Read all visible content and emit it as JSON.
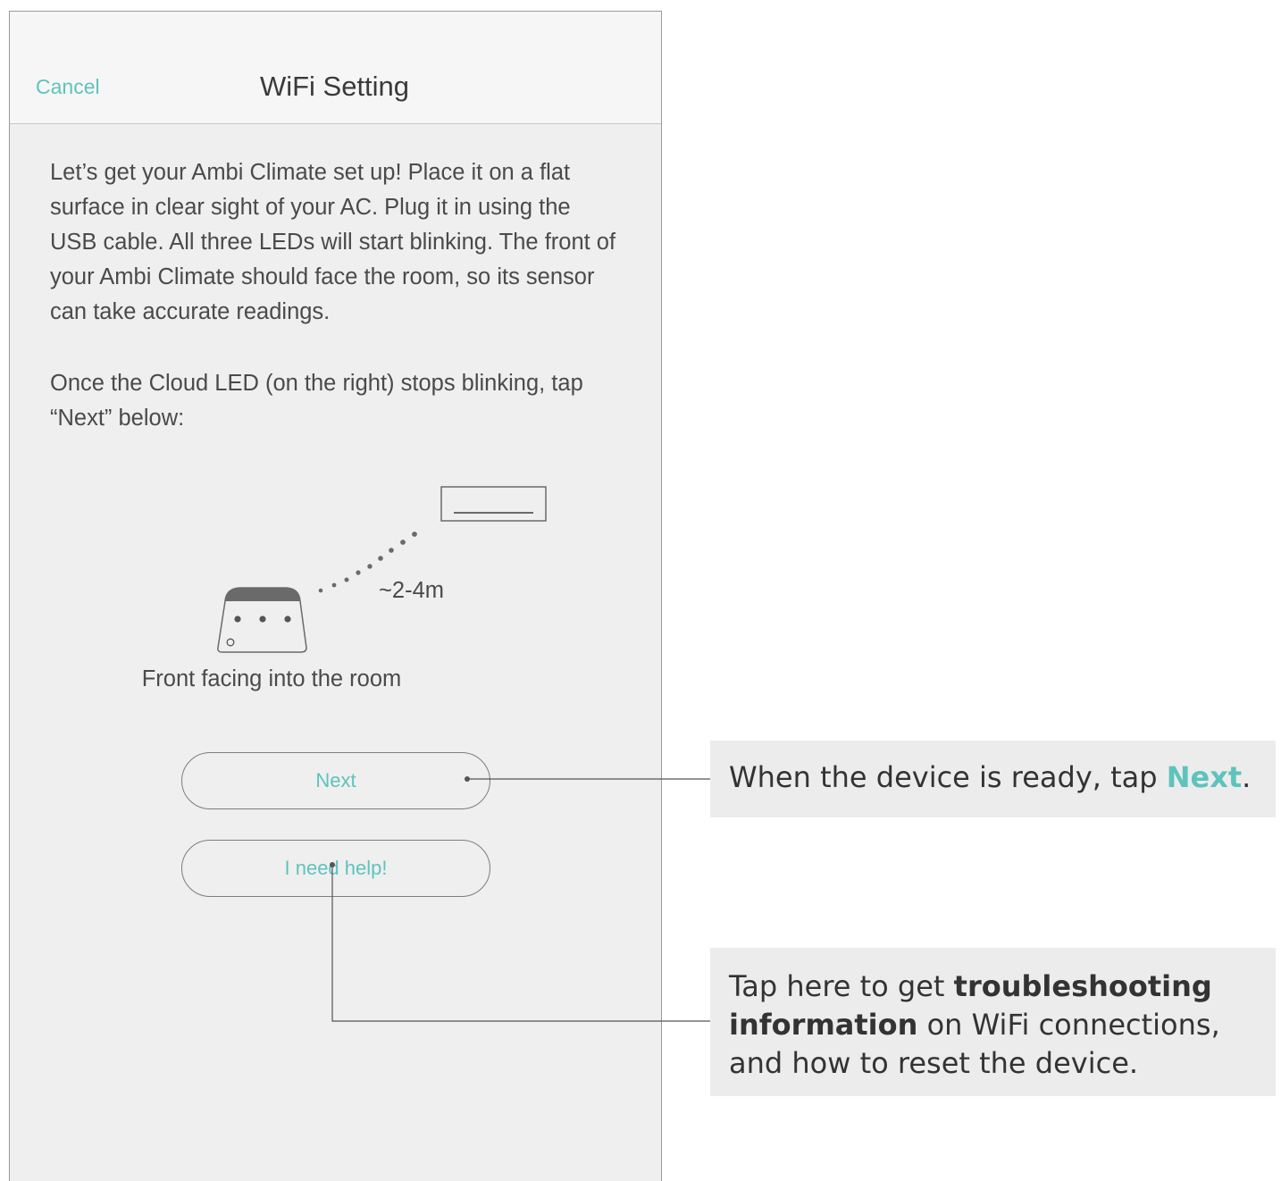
{
  "navbar": {
    "cancel_label": "Cancel",
    "title": "WiFi Setting"
  },
  "instructions": {
    "paragraph_1": "Let’s get your Ambi Climate set up! Place it on a flat surface in clear sight of your AC. Plug it in using the USB cable. All three LEDs will start blinking. The front of your Ambi Climate should face the room, so its sensor can take accurate readings.",
    "paragraph_2": "Once the Cloud LED (on the right) stops blinking, tap “Next” below:"
  },
  "illustration": {
    "distance_label": "~2-4m",
    "caption": "Front facing into the room"
  },
  "buttons": {
    "next_label": "Next",
    "help_label": "I need help!"
  },
  "callouts": {
    "next": {
      "prefix": "When the device is ready, tap ",
      "highlight": "Next",
      "suffix": "."
    },
    "help": {
      "prefix": "Tap here to get ",
      "bold": "troubleshooting information",
      "suffix": " on WiFi connections, and how to reset the device."
    }
  },
  "colors": {
    "accent": "#5ec3bd",
    "screen_background": "#efefef",
    "callout_background": "#ececec"
  }
}
